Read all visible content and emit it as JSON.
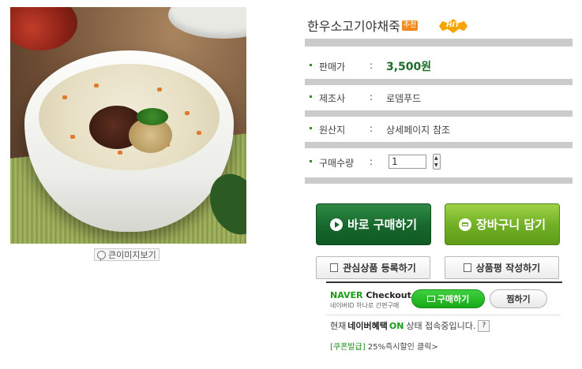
{
  "product": {
    "title": "한우소고기야채죽",
    "badge_recommend": "추천",
    "badge_hit": "HIT",
    "image_alt_icon": "zoom-icon",
    "zoom_label": "큰이미지보기"
  },
  "info_rows": [
    {
      "label": "판매가",
      "colon": ":",
      "value": "3,500원"
    },
    {
      "label": "제조사",
      "colon": ":",
      "value": "로뎀푸드"
    },
    {
      "label": "원산지",
      "colon": ":",
      "value": "상세페이지 참조"
    },
    {
      "label": "구매수량",
      "colon": ":",
      "value": ""
    }
  ],
  "quantity": {
    "value": "1"
  },
  "buttons": {
    "buy_now": "바로 구매하기",
    "add_cart": "장바구니 담기",
    "wishlist": "관심상품 등록하기",
    "write_review": "상품평 작성하기"
  },
  "naver_checkout": {
    "logo_naver": "NAVER",
    "logo_checkout": "Checkout",
    "subtitle": "네이버ID 하나로 간편구매",
    "buy_label": "구매하기",
    "wish_label": "찜하기"
  },
  "status": {
    "prefix": "현재",
    "benefit": "네이버혜택",
    "on": "ON",
    "suffix": "상태 접속중입니다.",
    "help": "?"
  },
  "coupon": {
    "tag": "[쿠폰발급]",
    "text": "25%즉시할인 클릭>"
  },
  "colors": {
    "accent_green": "#17672d",
    "cart_green": "#6fae23",
    "price_green": "#1e6b2a",
    "naver_green": "#1a9c1a"
  }
}
